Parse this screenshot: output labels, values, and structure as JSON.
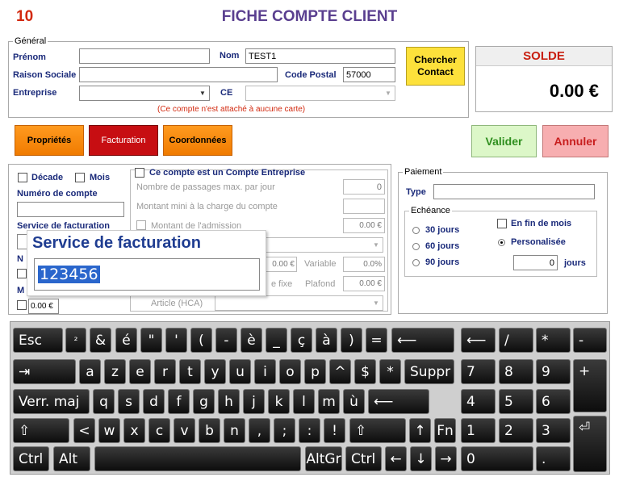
{
  "header": {
    "number": "10",
    "title": "FICHE COMPTE CLIENT"
  },
  "general": {
    "legend": "Général",
    "prenom_label": "Prénom",
    "prenom_value": "",
    "nom_label": "Nom",
    "nom_value": "TEST1",
    "raison_label": "Raison Sociale",
    "raison_value": "",
    "code_postal_label": "Code Postal",
    "code_postal_value": "57000",
    "entreprise_label": "Entreprise",
    "entreprise_value": "",
    "ce_label": "CE",
    "ce_value": "",
    "notice": "(Ce compte n'est attaché à aucune carte)",
    "search_button": "Chercher Contact"
  },
  "solde": {
    "label": "SOLDE",
    "value": "0.00 €"
  },
  "tabs": [
    {
      "label": "Propriétés"
    },
    {
      "label": "Facturation"
    },
    {
      "label": "Coordonnées"
    }
  ],
  "actions": {
    "validate": "Valider",
    "cancel": "Annuler"
  },
  "facturation": {
    "decade_label": "Décade",
    "mois_label": "Mois",
    "account_number_label": "Numéro de compte",
    "account_number_value": "",
    "service_label": "Service de facturation",
    "field_n": "N",
    "field_m": "M",
    "mois_amount": "0.00 €"
  },
  "entreprise": {
    "checkbox_label": "Ce compte est un Compte Entreprise",
    "passages_label": "Nombre de passages max. par jour",
    "passages_value": "0",
    "montant_mini_label": "Montant mini à la charge du compte",
    "montant_mini_value": "",
    "admission_label": "Montant de l'admission",
    "admission_value": "0.00 €",
    "row_amount_value": "0.00 €",
    "variable_label": "Variable",
    "variable_value": "0.0%",
    "fixe_label": "e fixe",
    "plafond_label": "Plafond",
    "plafond_value": "0.00 €",
    "article_label": "Article (HCA)"
  },
  "popup": {
    "title": "Service de facturation",
    "value": "123456"
  },
  "paiement": {
    "legend": "Paiement",
    "type_label": "Type",
    "type_value": "",
    "echeance_legend": "Echéance",
    "options": [
      "30 jours",
      "60 jours",
      "90 jours"
    ],
    "fin_mois_label": "En fin de mois",
    "personnalisee_label": "Personalisée",
    "days_value": "0",
    "days_unit": "jours"
  },
  "keyboard": {
    "row1": [
      "Esc",
      "²",
      "&",
      "é",
      "\"",
      "'",
      "(",
      "-",
      "è",
      "_",
      "ç",
      "à",
      ")",
      "=",
      "⟵"
    ],
    "row2": [
      "a",
      "z",
      "e",
      "r",
      "t",
      "y",
      "u",
      "i",
      "o",
      "p",
      "^",
      "$",
      "*",
      "Suppr"
    ],
    "row3": [
      "Verr. maj",
      "q",
      "s",
      "d",
      "f",
      "g",
      "h",
      "j",
      "k",
      "l",
      "m",
      "ù",
      "⟵"
    ],
    "row4": [
      "<",
      "w",
      "x",
      "c",
      "v",
      "b",
      "n",
      ",",
      ";",
      ":",
      "!",
      "↑",
      "Fn"
    ],
    "row5": [
      "Ctrl",
      "Alt",
      "AltGr",
      "Ctrl",
      "←",
      "↓",
      "→"
    ],
    "numpad": [
      "⟵",
      "/",
      "*",
      "-",
      "7",
      "8",
      "9",
      "+",
      "4",
      "5",
      "6",
      "1",
      "2",
      "3",
      "⏎",
      "0",
      "."
    ]
  }
}
